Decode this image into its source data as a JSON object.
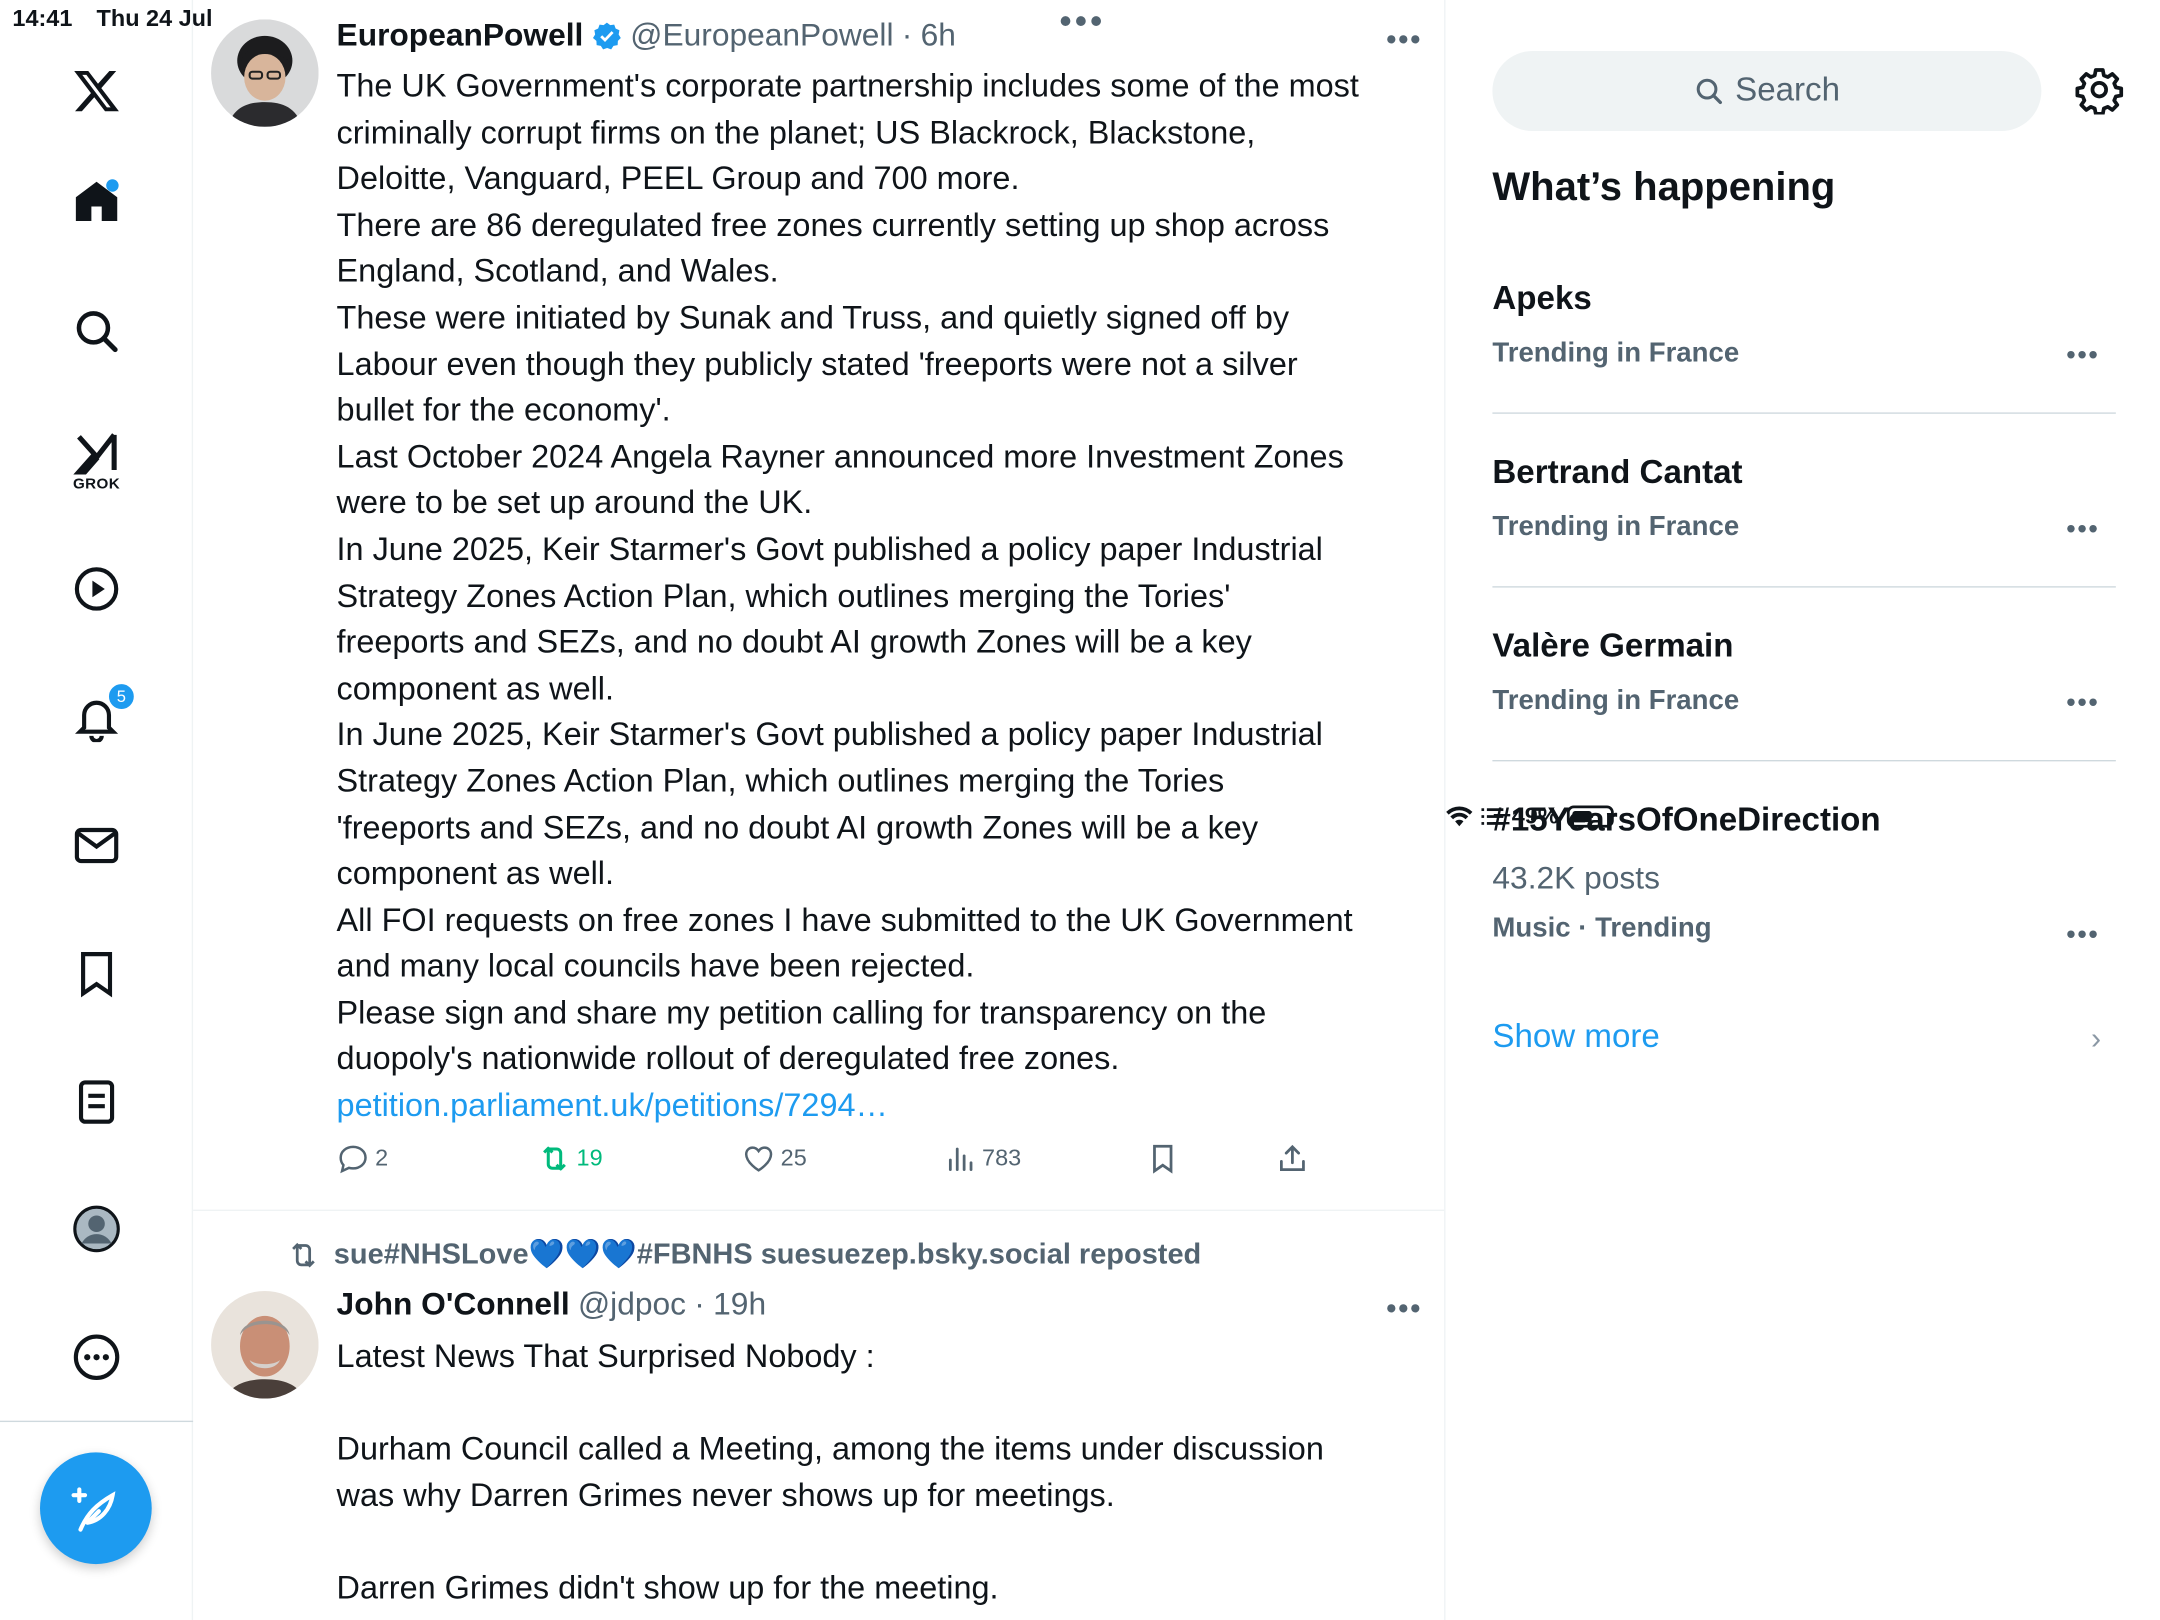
{
  "status_bar": {
    "time": "14:41",
    "date": "Thu 24 Jul",
    "battery": "49%"
  },
  "nav": {
    "items": [
      "x-logo",
      "home",
      "search",
      "grok",
      "video",
      "notifications",
      "messages",
      "bookmarks",
      "lists",
      "profile",
      "more"
    ],
    "grok_label": "GROK",
    "notifications_badge": "5"
  },
  "feed": {
    "tweet1": {
      "name": "EuropeanPowell",
      "handle": "@EuropeanPowell",
      "sep": "·",
      "time": "6h",
      "body": "The UK Government's corporate partnership includes some of the most\ncriminally corrupt firms on the planet; US Blackrock, Blackstone,\nDeloitte, Vanguard, PEEL Group and 700 more.\nThere are 86 deregulated free zones currently setting up shop across\nEngland, Scotland, and Wales.\nThese were initiated by Sunak and Truss, and quietly signed off by\nLabour even though they publicly stated 'freeports were not a silver\nbullet for the economy'.\nLast October 2024 Angela Rayner announced more Investment Zones\nwere to be set up around the UK.\nIn June 2025, Keir Starmer's Govt published a policy paper Industrial\nStrategy Zones Action Plan, which outlines merging the Tories'\nfreeports and SEZs, and no doubt AI growth Zones will be a key\ncomponent as well.\nIn June 2025, Keir Starmer's Govt published a policy paper Industrial\nStrategy Zones Action Plan, which outlines merging the Tories\n'freeports and SEZs, and no doubt AI growth Zones will be a key\ncomponent as well.\nAll FOI requests on free zones I have submitted to the UK Government\nand many local councils have been rejected.\nPlease sign and share my petition calling for transparency on the\nduopoly's nationwide rollout of deregulated free zones.",
      "link": "petition.parliament.uk/petitions/7294…",
      "replies": "2",
      "reposts": "19",
      "likes": "25",
      "views": "783"
    },
    "tweet2": {
      "reposted_by": "sue#NHSLove💙💙💙#FBNHS suesuezep.bsky.social reposted",
      "name": "John O'Connell",
      "handle": "@jdpoc",
      "sep": "·",
      "time": "19h",
      "body": "Latest News That Surprised Nobody :\n\nDurham Council called a Meeting, among the items under discussion\nwas why Darren Grimes never shows up for meetings.\n\nDarren Grimes didn't show up for the meeting."
    }
  },
  "sidebar": {
    "search_placeholder": "Search",
    "heading": "What’s happening",
    "trends": [
      {
        "title": "Apeks",
        "context": "Trending in France"
      },
      {
        "title": "Bertrand Cantat",
        "context": "Trending in France"
      },
      {
        "title": "Valère Germain",
        "context": "Trending in France"
      },
      {
        "title": "#15YearsOfOneDirection",
        "posts": "43.2K posts",
        "context": "Music · Trending"
      }
    ],
    "show_more": "Show more"
  },
  "colors": {
    "accent": "#1d9bf0",
    "repost_green": "#00ba7c",
    "muted": "#536471"
  }
}
